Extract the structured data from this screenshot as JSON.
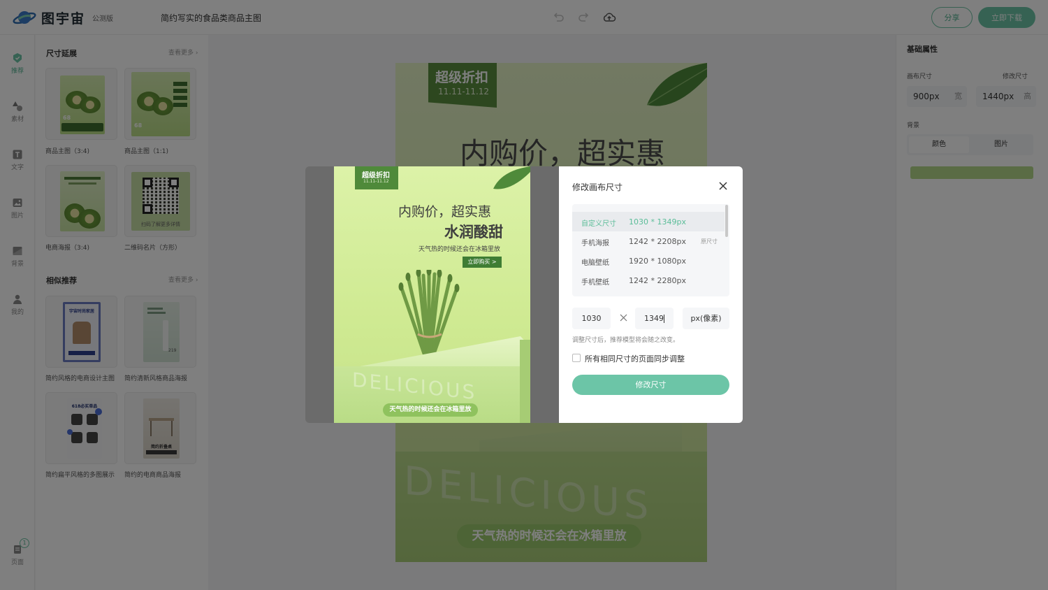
{
  "app": {
    "logo_text": "图宇宙",
    "beta": "公测版",
    "doc_title": "简约写实的食品类商品主图",
    "share_label": "分享",
    "download_label": "立即下载"
  },
  "rail": {
    "items": [
      {
        "label": "推荐",
        "icon": "recommend-icon"
      },
      {
        "label": "素材",
        "icon": "shapes-icon"
      },
      {
        "label": "文字",
        "icon": "text-icon"
      },
      {
        "label": "图片",
        "icon": "image-icon"
      },
      {
        "label": "背景",
        "icon": "background-icon"
      },
      {
        "label": "我的",
        "icon": "user-icon"
      }
    ],
    "pages_label": "页面",
    "pages_count": "1"
  },
  "left_panel": {
    "size_section": {
      "title": "尺寸延展",
      "see_more": "查看更多",
      "items": [
        {
          "caption": "商品主图（3:4)"
        },
        {
          "caption": "商品主图（1:1)"
        },
        {
          "caption": "电商海报（3:4)"
        },
        {
          "caption": "二维码名片（方形）"
        }
      ]
    },
    "similar_section": {
      "title": "相似推荐",
      "see_more": "查看更多",
      "items": [
        {
          "caption": "简约风格的电商设计主图"
        },
        {
          "caption": "简约清新风格商品海报"
        },
        {
          "caption": "简约扁平风格的多图展示"
        },
        {
          "caption": "简约的电商商品海报"
        }
      ]
    },
    "thumb_texts": {
      "t1_tag": "68",
      "t2_tag": "68",
      "t4_caption": "扫码了解更多详情",
      "s1_title": "宇宙时尚家居",
      "s3_title": "618必买单品",
      "s4_title": "简约折叠桌"
    }
  },
  "poster": {
    "badge_title": "超级折扣",
    "badge_date": "11.11-11.12",
    "headline": "内购价，超实惠",
    "subhead": "水润酸甜",
    "tagline": "天气热的时候还会在冰箱里放",
    "cta": "立即购买 >",
    "watermark": "DELICIOUS",
    "bottom_pill": "天气热的时候还会在冰箱里放"
  },
  "right_panel": {
    "title": "基础属性",
    "canvas_size_label": "画布尺寸",
    "edit_size_label": "修改尺寸",
    "width_value": "900px",
    "width_unit": "宽",
    "height_value": "1440px",
    "height_unit": "高",
    "background_label": "背景",
    "bg_tabs": [
      "颜色",
      "图片"
    ],
    "bg_color": "#b5d88a"
  },
  "modal": {
    "title": "修改画布尺寸",
    "sizes": [
      {
        "name": "自定义尺寸",
        "dim": "1030 * 1349px",
        "tag": "",
        "selected": true
      },
      {
        "name": "手机海报",
        "dim": "1242 * 2208px",
        "tag": "原尺寸",
        "selected": false
      },
      {
        "name": "电脑壁纸",
        "dim": "1920 * 1080px",
        "tag": "",
        "selected": false
      },
      {
        "name": "手机壁纸",
        "dim": "1242 * 2280px",
        "tag": "",
        "selected": false
      }
    ],
    "width_input": "1030",
    "height_input": "1349",
    "unit_select": "px(像素)",
    "hint": "调整尺寸后，推荐模型将会随之改变。",
    "sync_label": "所有相同尺寸的页面同步调整",
    "sync_checked": false,
    "submit_label": "修改尺寸"
  },
  "colors": {
    "accent": "#6cc5a7",
    "accent_text": "#4fb08e",
    "poster_green_dark": "#4f8a3a",
    "poster_green_light": "#dcf2a8"
  }
}
